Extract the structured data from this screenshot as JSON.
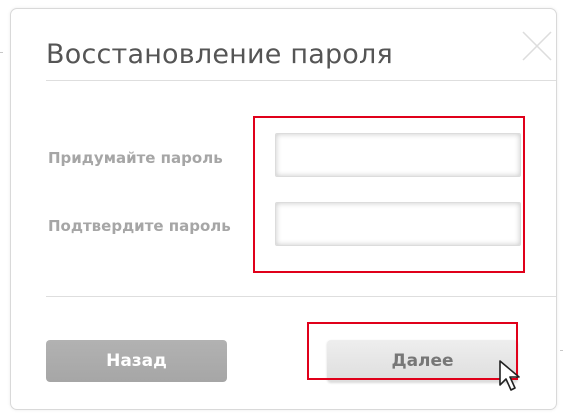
{
  "dialog": {
    "title": "Восстановление пароля",
    "close_icon": "close-x-icon",
    "fields": [
      {
        "label": "Придумайте пароль",
        "value": "",
        "placeholder": ""
      },
      {
        "label": "Подтвердите пароль",
        "value": "",
        "placeholder": ""
      }
    ],
    "buttons": {
      "back_label": "Назад",
      "next_label": "Далее"
    }
  },
  "annotations": {
    "highlight_color": "#e0001a"
  },
  "colors": {
    "title_text": "#555555",
    "label_text": "#a6a6a6",
    "back_button_bg": "#a6a6a6",
    "next_button_bg": "#e6e6e6"
  },
  "cursor_icon": "arrow-pointer-icon"
}
